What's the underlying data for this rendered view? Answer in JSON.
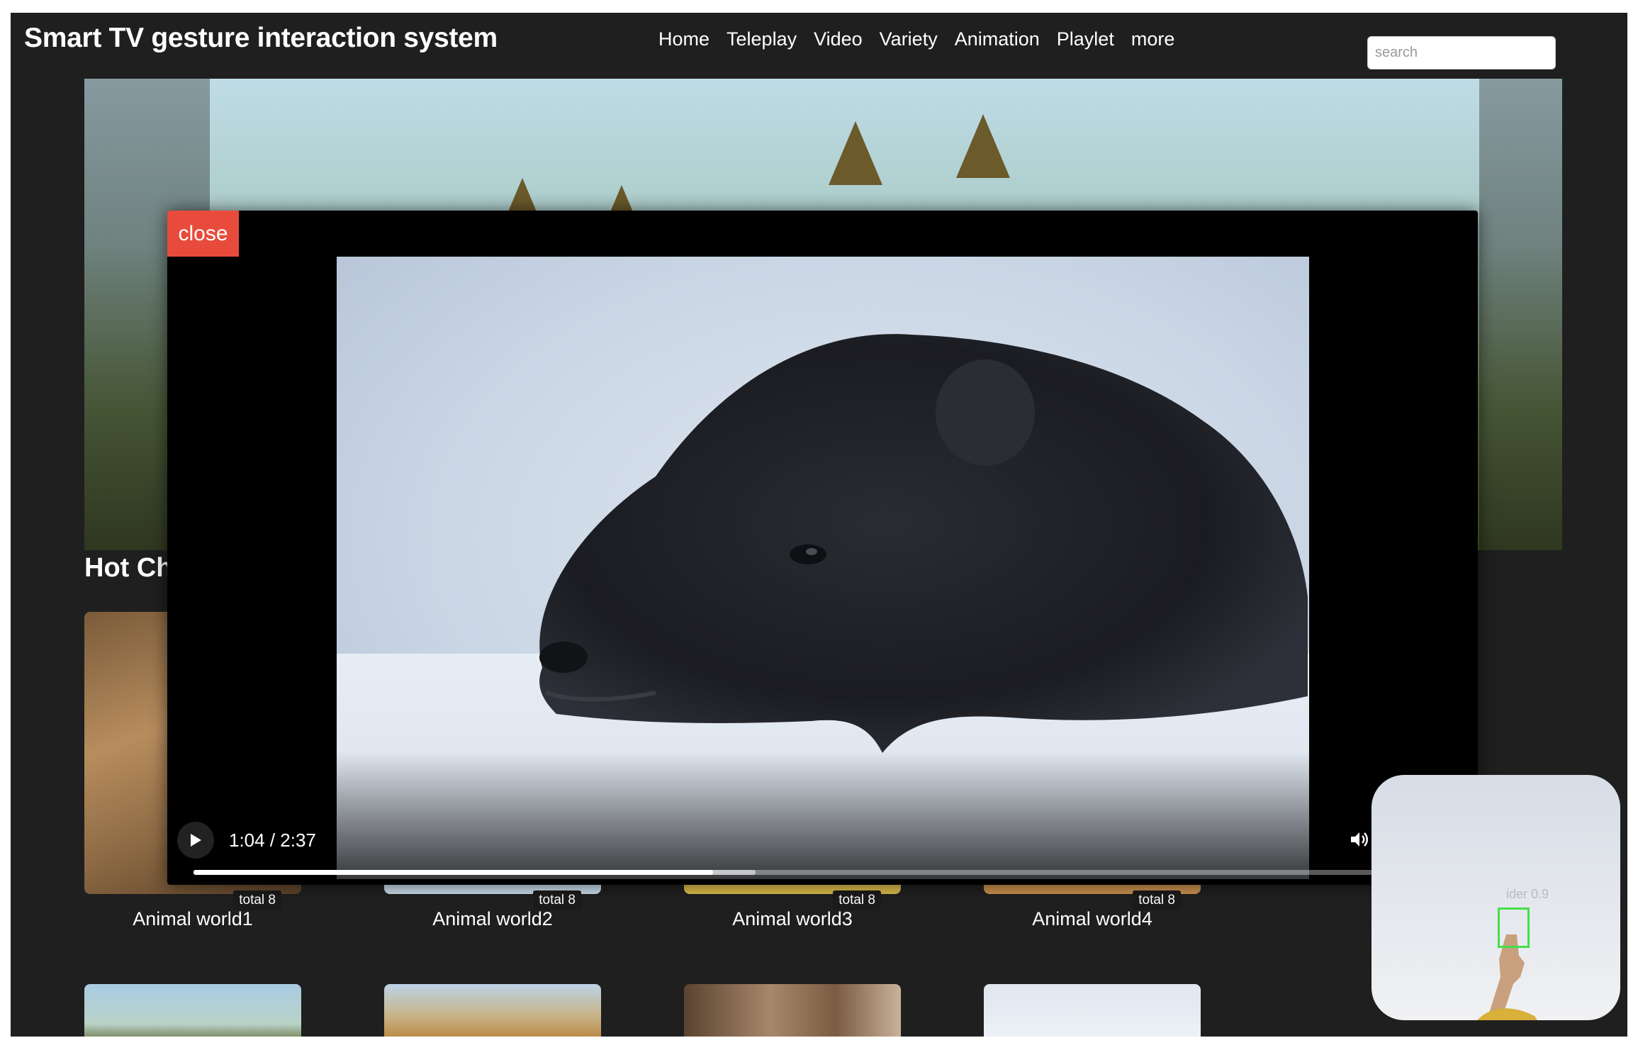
{
  "header": {
    "title": "Smart TV gesture interaction system",
    "nav": [
      "Home",
      "Teleplay",
      "Video",
      "Variety",
      "Animation",
      "Playlet",
      "more"
    ],
    "search_placeholder": "search"
  },
  "section": {
    "title": "Hot Ch"
  },
  "cards": [
    {
      "label": "Animal world1",
      "badge": "total 8"
    },
    {
      "label": "Animal world2",
      "badge": "total 8"
    },
    {
      "label": "Animal world3",
      "badge": "total 8"
    },
    {
      "label": "Animal world4",
      "badge": "total 8"
    }
  ],
  "player": {
    "close_label": "close",
    "time": "1:04 / 2:37",
    "progress": 0.407,
    "buffered": 0.44
  },
  "gesture": {
    "overlay_text": "ider 0.9"
  },
  "colors": {
    "close_button": "#e84b3c",
    "page_bg": "#1f1f1f",
    "gesture_box": "#43e04a"
  },
  "icons": {
    "play": "play-icon",
    "volume": "volume-icon",
    "fullscreen": "fullscreen-icon",
    "more": "more-vertical-icon"
  }
}
